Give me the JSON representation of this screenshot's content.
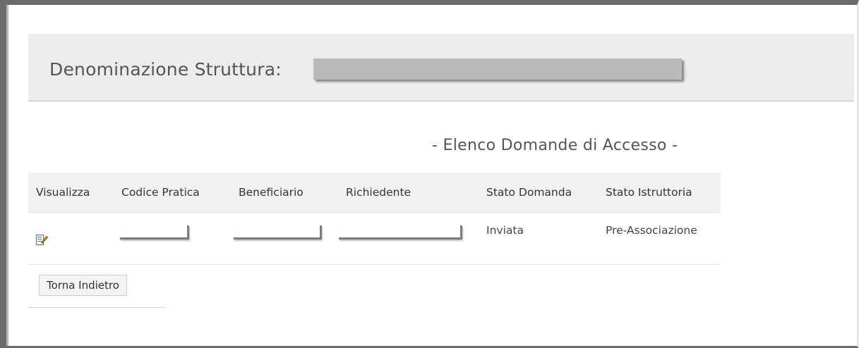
{
  "header": {
    "label": "Denominazione Struttura:"
  },
  "list": {
    "title": "- Elenco Domande di Accesso -"
  },
  "table": {
    "columns": [
      "Visualizza",
      "Codice Pratica",
      "Beneficiario",
      "Richiedente",
      "Stato Domanda",
      "Stato Istruttoria"
    ],
    "rows": [
      {
        "visualizza_icon": "edit-document-icon",
        "codice_pratica": "",
        "beneficiario": "",
        "richiedente": "",
        "stato_domanda": "Inviata",
        "stato_istruttoria": "Pre-Associazione"
      }
    ]
  },
  "actions": {
    "back_label": "Torna Indietro"
  }
}
